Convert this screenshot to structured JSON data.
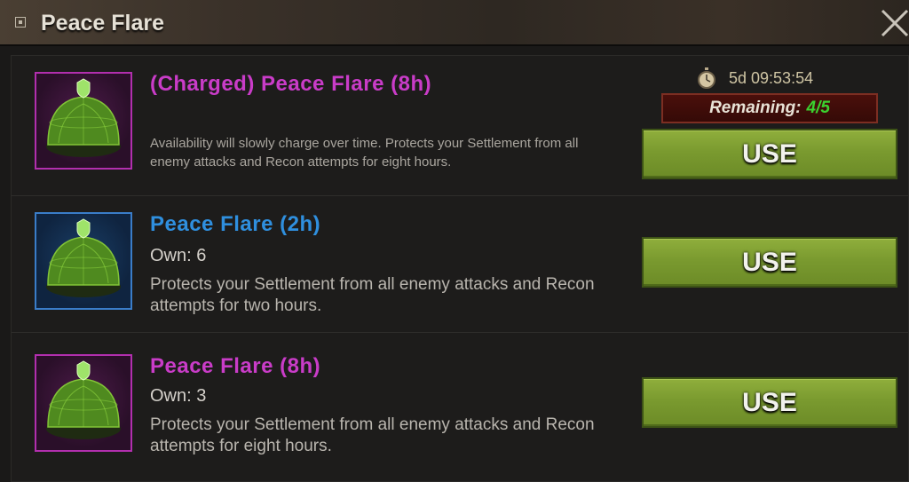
{
  "window": {
    "title": "Peace Flare"
  },
  "items": [
    {
      "name": "(Charged) Peace Flare (8h)",
      "rarity_color": "#c93cc8",
      "timer": "5d 09:53:54",
      "remaining_label": "Remaining:",
      "remaining_value": "4/5",
      "description": "Availability will slowly charge over time. Protects your Settlement from all enemy attacks and Recon attempts for eight hours.",
      "button_label": "USE"
    },
    {
      "name": "Peace Flare (2h)",
      "rarity_color": "#2f8fde",
      "own": "Own: 6",
      "description": "Protects your Settlement from all enemy attacks and Recon attempts for two hours.",
      "button_label": "USE"
    },
    {
      "name": "Peace Flare (8h)",
      "rarity_color": "#c93cc8",
      "own": "Own: 3",
      "description": "Protects your Settlement from all enemy attacks and Recon attempts for eight hours.",
      "button_label": "USE"
    }
  ],
  "icons": {
    "close": "close-icon",
    "item": "shield-dome-icon",
    "timer": "stopwatch-icon"
  }
}
